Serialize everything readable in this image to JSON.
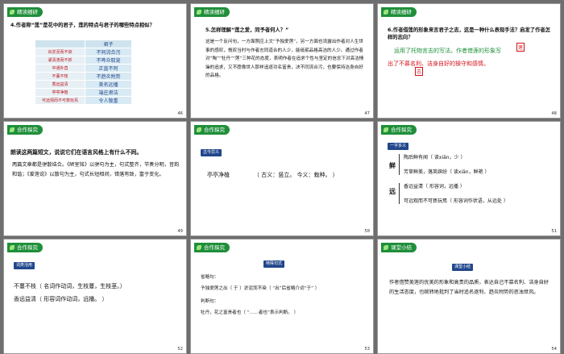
{
  "slides": [
    {
      "badge": "精读细研",
      "question": "4.作者称“莲”是花中的君子，莲的特点与君子的哪些特点相似？",
      "table_header": "君子",
      "rows": [
        {
          "left": "出淤泥而不染",
          "right": "不同流合污"
        },
        {
          "left": "濯清涟而不妖",
          "right": "不哗众取宠"
        },
        {
          "left": "中通外直",
          "right": "正直不阿"
        },
        {
          "left": "不蔓不枝",
          "right": "不趋炎附势"
        },
        {
          "left": "香远益清",
          "right": "美名远播"
        },
        {
          "left": "亭亭净植",
          "right": "端庄肃洁"
        },
        {
          "left": "可远观而不可亵玩焉",
          "right": "令人敬重"
        }
      ],
      "num": "46"
    },
    {
      "badge": "精读细研",
      "question": "5.怎样理解“莲之爱，同予者何人？”",
      "answer": "这是一个反问句，一方面照应上文“予独爱莲”，另一方面也流露出作者对人生世事的感叹，慨叹当时与作者志同道合的人少，能砥砺品格高洁的人少。通过作者对“陶”“牡丹”“莲”三种花的态度，表明作者在追求个性与坚定的信念下对高洁情操的追求，又不愿像世人那样追逐功名富贵，决不同流合污，也要保持洁身自好的品格。",
      "num": "47"
    },
    {
      "badge": "精读细研",
      "question": "6.作者借莲的形象来言君子之志，这是一种什么表现手法？启发了作者怎样的志向？",
      "answer_a": "运用了托物言志的写法。作者借莲的形象写",
      "answer_b": "出了不慕名利、洁身自好的操守和感情。",
      "mark1": "莲",
      "mark2": "志",
      "num": "48"
    },
    {
      "badge": "合作探究",
      "question": "朗读这两篇短文，说说它们在语言风格上有什么不同。",
      "answer": "两篇文章都是骈散结合。《陋室铭》以骈句为主，句式整齐，节奏分明，音韵和谐；《爱莲说》以散句为主，句式长短相间，错落有致，富于变化。",
      "num": "49"
    },
    {
      "badge": "合作探究",
      "tag": "古今异义",
      "word": "亭亭净植",
      "gloss": "（ 古义：竖立。 今义：栽种。 ）",
      "num": "50"
    },
    {
      "badge": "合作探究",
      "tag": "一字多义",
      "head": "鲜",
      "head2": "远",
      "lines": [
        "陶后鲜有闻（ 读xiǎn，少 ）",
        "芳草鲜美，落英缤纷（ 读xiān，鲜艳 ）",
        "香远益清（ 形容词，远播 ）",
        "可远观而不可亵玩焉（ 形容词作状语，从远处 ）"
      ],
      "num": "51"
    },
    {
      "badge": "合作探究",
      "tag": "词类活用",
      "line1": "不蔓不枝（ 名词作动词，生枝蔓，生枝茎。）",
      "line2": "香远益清（ 形容词作动词，远播。 ）",
      "num": "52"
    },
    {
      "badge": "合作探究",
      "tag": "特殊句式",
      "l1": "省略句：",
      "l2": "予独爱莲之出（ 于 ）淤泥而不染（ “出”后省略介词“于” ）",
      "l3": "判断句：",
      "l4": "牡丹，花之富贵者也（ “……者也”表示判断。 ）",
      "num": "53"
    },
    {
      "badge": "课堂小结",
      "tag": "课堂小结",
      "text": "作者借赞美莲的优美的形象和高贵的品质，表达自己不慕名利、洁身自好的生活态度，也婉转地批判了当时追名逐利、趋炎附势的恶浊世风。",
      "num": "54"
    }
  ],
  "colors": {
    "accent_green": "#1f8f3a",
    "answer_red": "#d2131a",
    "tag_blue": "#21478c"
  }
}
